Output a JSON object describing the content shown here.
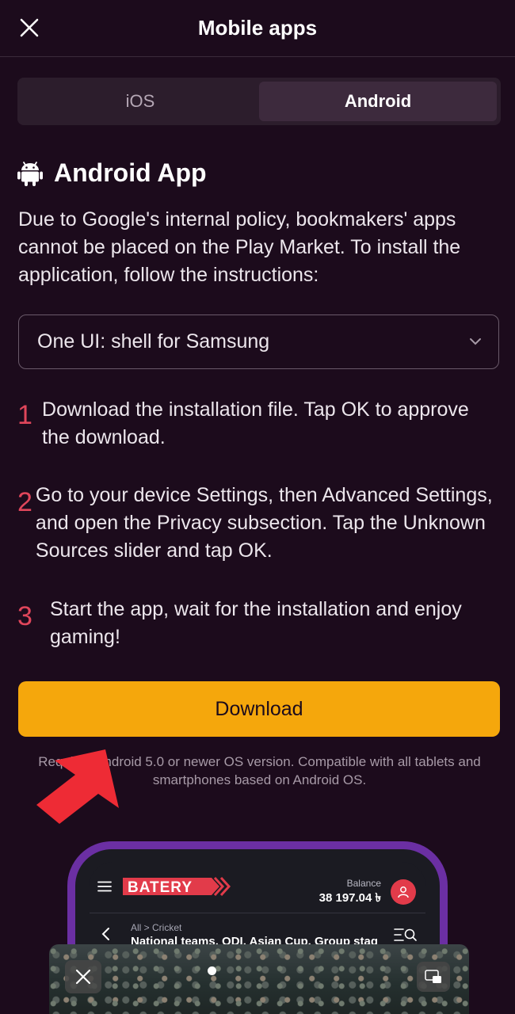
{
  "header": {
    "title": "Mobile apps",
    "close_icon": "close-icon"
  },
  "tabs": [
    {
      "label": "iOS",
      "active": false
    },
    {
      "label": "Android",
      "active": true
    }
  ],
  "section": {
    "title": "Android App",
    "icon": "android-icon",
    "intro": "Due to Google's internal policy, bookmakers' apps cannot be placed on the Play Market. To install the application, follow the instructions:"
  },
  "shell_select": {
    "value": "One UI: shell for Samsung",
    "icon": "chevron-down-icon"
  },
  "steps": [
    {
      "num": "1",
      "text": "Download the installation file. Tap OK to approve the download."
    },
    {
      "num": "2",
      "text": "Go to your device Settings, then Advanced Settings, and open the Privacy subsection. Tap the Unknown Sources slider and tap OK."
    },
    {
      "num": "3",
      "text": "Start the app, wait for the installation and enjoy gaming!"
    }
  ],
  "download": {
    "label": "Download",
    "color": "#f5a70c"
  },
  "requirements": "Requires Android 5.0 or newer OS version. Compatible with all tablets and smartphones based on Android OS.",
  "phone_preview": {
    "logo": "BATERY",
    "balance_label": "Balance",
    "balance_value": "38 197.04 ৳",
    "breadcrumb": "All > Cricket",
    "match_title": "National teams. ODI. Asian Cup. Group stag",
    "frame_color": "#6b2fa3"
  },
  "colors": {
    "background": "#1c0b1c",
    "accent": "#f5a70c",
    "step_number": "#e0465b",
    "arrow": "#ee2b35"
  }
}
